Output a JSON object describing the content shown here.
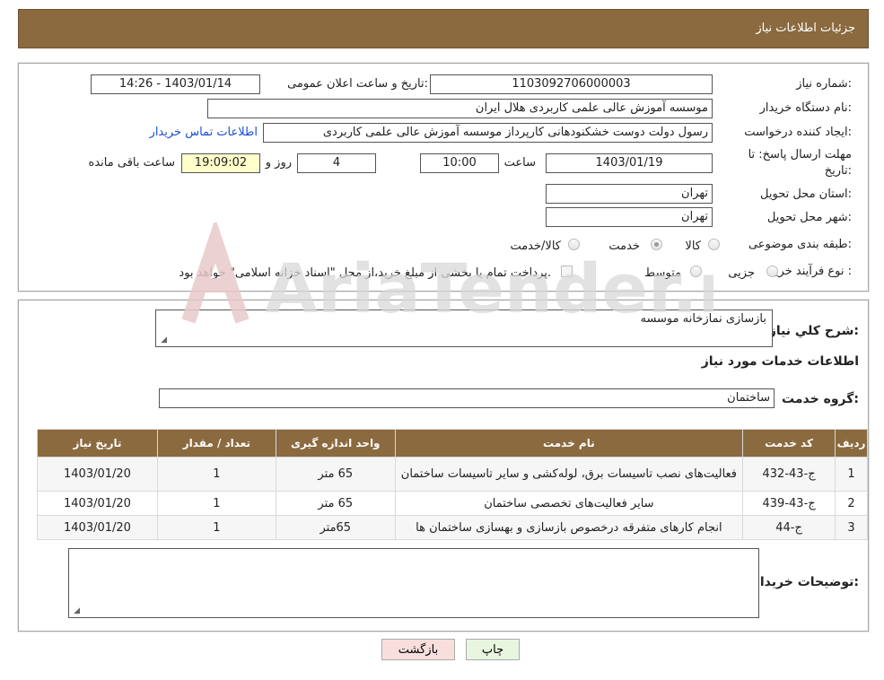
{
  "header": {
    "title": "جزئیات اطلاعات نیاز"
  },
  "form": {
    "need_number_label": "شماره نیاز:",
    "need_number": "1103092706000003",
    "announce_label": "تاریخ و ساعت اعلان عمومی:",
    "announce_value": "1403/01/14 - 14:26",
    "buyer_org_label": "نام دستگاه خریدار:",
    "buyer_org": "موسسه آموزش عالی علمی کاربردی هلال ایران",
    "creator_label": "ایجاد کننده درخواست:",
    "creator": "رسول دولت دوست خشکنودهانی کارپرداز موسسه آموزش عالی علمی کاربردی",
    "contact_link": "اطلاعات تماس خریدار",
    "deadline_label_1": "مهلت ارسال پاسخ: تا",
    "deadline_label_2": "تاریخ:",
    "deadline_date": "1403/01/19",
    "hour_label": "ساعت",
    "deadline_time": "10:00",
    "days_value": "4",
    "days_label": "روز و",
    "remaining_time": "19:09:02",
    "remaining_label": "ساعت باقی مانده",
    "province_label": "استان محل تحویل:",
    "province": "تهران",
    "city_label": "شهر محل تحویل:",
    "city": "تهران",
    "category_label": "طبقه بندی موضوعی:",
    "category_goods": "کالا",
    "category_service": "خدمت",
    "category_both": "کالا/خدمت",
    "process_label": "نوع فرآیند خرید :",
    "process_small": "جزیی",
    "process_medium": "متوسط",
    "payment_note": "پرداخت تمام یا بخشی از مبلغ خرید،از محل \"اسناد خزانه اسلامی\" خواهد بود."
  },
  "details": {
    "summary_label": "شرح کلي نياز:",
    "summary": "بازسازی نمازخانه موسسه",
    "services_title": "اطلاعات خدمات مورد نیاز",
    "group_label": "گروه خدمت:",
    "group": "ساختمان",
    "table": {
      "headers": [
        "ردیف",
        "کد خدمت",
        "نام خدمت",
        "واحد اندازه گیری",
        "تعداد / مقدار",
        "تاریخ نیاز"
      ],
      "rows": [
        [
          "1",
          "ج-43-432",
          "فعالیت‌های نصب تاسیسات برق، لوله‌کشی و سایر تاسیسات ساختمان",
          "65 متر",
          "1",
          "1403/01/20"
        ],
        [
          "2",
          "ج-43-439",
          "سایر فعالیت‌های تخصصی ساختمان",
          "65 متر",
          "1",
          "1403/01/20"
        ],
        [
          "3",
          "ج-44",
          "انجام کارهای متفرقه درخصوص بازسازی و بهسازی ساختمان ها",
          "65متر",
          "1",
          "1403/01/20"
        ]
      ]
    },
    "buyer_notes_label": "توضیحات خریدار:"
  },
  "buttons": {
    "print": "چاپ",
    "back": "بازگشت"
  },
  "watermark": {
    "text": "AriaTender.neT"
  },
  "colors": {
    "header_bg": "#8b6a3f",
    "link": "#1a4fd6",
    "remaining_bg": "#ffffcc"
  }
}
